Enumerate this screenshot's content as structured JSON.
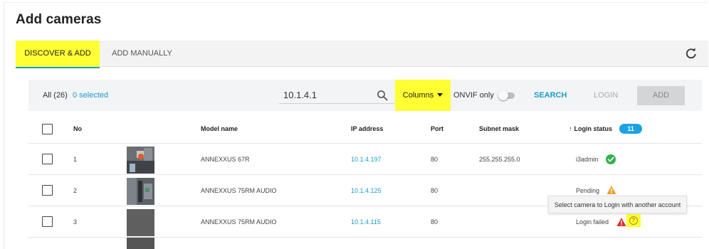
{
  "page": {
    "title": "Add cameras"
  },
  "tabs": [
    {
      "label": "DISCOVER & ADD",
      "active": true
    },
    {
      "label": "ADD MANUALLY",
      "active": false
    }
  ],
  "toolbar": {
    "all_count": "All (26)",
    "selected": "0 selected",
    "search_value": "10.1.4.1",
    "columns_label": "Columns",
    "onvif_label": "ONVIF only",
    "onvif_enabled": false,
    "search_label": "SEARCH",
    "login_label": "LOGIN",
    "add_label": "ADD"
  },
  "table": {
    "headers": {
      "no": "No",
      "model": "Model name",
      "ip": "IP address",
      "port": "Port",
      "mask": "Subnet mask",
      "login": "Login status",
      "login_count": "11"
    },
    "rows": [
      {
        "no": "1",
        "model": "ANNEXXUS 67R",
        "ip": "10.1.4.197",
        "port": "80",
        "mask": "255.255.255.0",
        "login_status": "i3admin",
        "status_icon": "check-icon"
      },
      {
        "no": "2",
        "model": "ANNEXXUS 75RM AUDIO",
        "ip": "10.1.4.125",
        "port": "80",
        "mask": "",
        "login_status": "Pending",
        "status_icon": "warning-icon"
      },
      {
        "no": "3",
        "model": "ANNEXXUS 75RM AUDIO",
        "ip": "10.1.4.115",
        "port": "80",
        "mask": "",
        "login_status": "Login failed",
        "status_icon": "error-icon"
      }
    ]
  },
  "tooltip": {
    "text": "Select camera to Login with another account"
  },
  "colors": {
    "accent": "#1a9dc9",
    "highlight": "#ffff33",
    "success": "#2fb34a",
    "warning": "#f0a030",
    "error": "#d9302c",
    "badge": "#1aa3e0"
  },
  "icons": [
    "refresh-icon",
    "search-icon",
    "check-icon",
    "warning-icon",
    "error-icon",
    "help-icon"
  ]
}
